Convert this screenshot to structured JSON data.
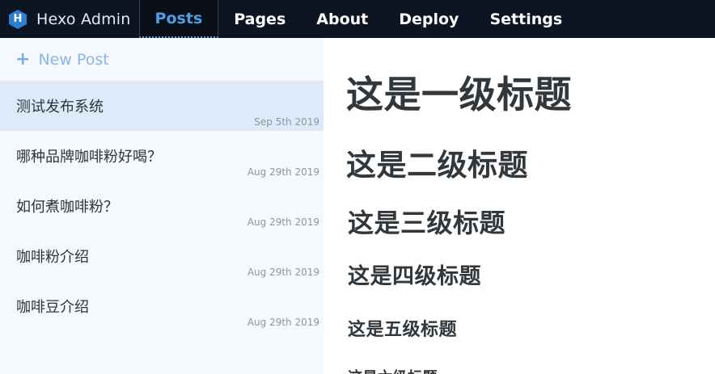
{
  "app": {
    "brand": "Hexo Admin",
    "logo_letter": "H"
  },
  "nav": {
    "tabs": [
      {
        "label": "Posts",
        "active": true
      },
      {
        "label": "Pages",
        "active": false
      },
      {
        "label": "About",
        "active": false
      },
      {
        "label": "Deploy",
        "active": false
      },
      {
        "label": "Settings",
        "active": false
      }
    ]
  },
  "sidebar": {
    "new_post_label": "New Post",
    "posts": [
      {
        "title": "测试发布系统",
        "date": "Sep 5th 2019",
        "selected": true
      },
      {
        "title": "哪种品牌咖啡粉好喝？",
        "date": "Aug 29th 2019",
        "selected": false
      },
      {
        "title": "如何煮咖啡粉？",
        "date": "Aug 29th 2019",
        "selected": false
      },
      {
        "title": "咖啡粉介绍",
        "date": "Aug 29th 2019",
        "selected": false
      },
      {
        "title": "咖啡豆介绍",
        "date": "Aug 29th 2019",
        "selected": false
      }
    ]
  },
  "preview": {
    "h1": "这是一级标题",
    "h2": "这是二级标题",
    "h3": "这是三级标题",
    "h4": "这是四级标题",
    "h5": "这是五级标题",
    "h6": "这是六级标题"
  },
  "colors": {
    "topbar": "#0e1522",
    "accent": "#4c9ee8",
    "sidebar_bg": "#f5f8fc",
    "selected_bg": "#dceaf9",
    "logo": "#2f7fd0"
  }
}
